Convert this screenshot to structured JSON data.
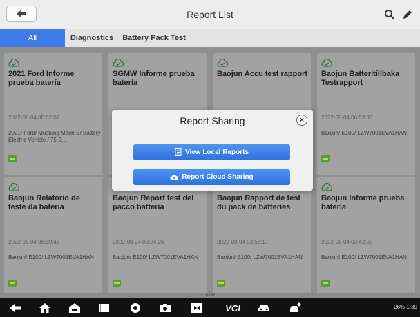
{
  "header": {
    "title": "Report List"
  },
  "tabs": [
    {
      "label": "All"
    },
    {
      "label": "Diagnostics"
    },
    {
      "label": "Battery Pack Test"
    }
  ],
  "cards": [
    {
      "title": "2021 Ford Informe prueba batería",
      "date": "2022-08-04 08:02:02",
      "vehicle": "2021/ Ford/ Mustang Mach-E/ Battery Electric Vehicle / 75-9..."
    },
    {
      "title": "SGMW Informe prueba batería",
      "date": "",
      "vehicle": ""
    },
    {
      "title": "Baojun Accu test rapport",
      "date": "",
      "vehicle": ""
    },
    {
      "title": "Baojun Batteritillbaka Testrapport",
      "date": "2022-08-04 06:53:33",
      "vehicle": "Baojun/ E100/ LZW7001EVA1HAN"
    },
    {
      "title": "Baojun Relatório de teste da bateria",
      "date": "2022-08-04 06:39:48",
      "vehicle": "Baojun/ E100/ LZW7001EVA1HAN"
    },
    {
      "title": "Baojun Report test del pacco batteria",
      "date": "2022-08-04 06:24:26",
      "vehicle": "Baojun/ E100/ LZW7001EVA1HAN"
    },
    {
      "title": "Baojun Rapport de test du pack de batteries",
      "date": "2022-08-04 03:58:17",
      "vehicle": "Baojun/ E100/ LZW7001EVA1HAN"
    },
    {
      "title": "Baojun Informe prueba batería",
      "date": "2022-08-04 03:42:03",
      "vehicle": "Baojun/ E100/ LZW7001EVA1HAN"
    }
  ],
  "pager": "1/137",
  "dialog": {
    "title": "Report Sharing",
    "close": "×",
    "local_label": "View Local Reports",
    "cloud_label": "Report Cloud Sharing"
  },
  "navbar": {
    "vci_label": "VCI",
    "status": "26% 1:39"
  },
  "icons": {
    "back": "back-arrow-icon",
    "search": "search-icon",
    "edit": "pencil-icon",
    "cloud": "cloud-check-icon",
    "battery": "battery-icon"
  },
  "colors": {
    "accent": "#3d7be8",
    "button": "#2e72dc",
    "battery": "#5b9e2f"
  }
}
